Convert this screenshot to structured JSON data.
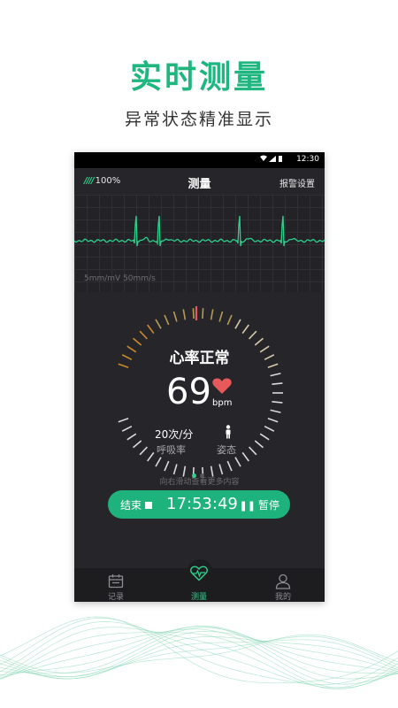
{
  "promo": {
    "title": "实时测量",
    "subtitle": "异常状态精准显示"
  },
  "status_bar": {
    "time": "12:30",
    "icons": [
      "wifi-icon",
      "signal-icon",
      "battery-icon"
    ]
  },
  "header": {
    "battery_text": "100%",
    "battery_bars": "////",
    "title": "测量",
    "alarm_settings": "报警设置"
  },
  "ecg": {
    "scale_label": "5mm/mV  50mm/s"
  },
  "measurement": {
    "status": "心率正常",
    "heart_rate": "69",
    "heart_rate_unit": "bpm",
    "respiration_value": "20次/分",
    "respiration_label": "呼吸率",
    "posture_label": "姿态",
    "page_count": 2,
    "active_page": 0,
    "swipe_hint": "向右滑动查看更多内容"
  },
  "controls": {
    "end_label": "结束",
    "timer": "17:53:49",
    "pause_label": "暂停"
  },
  "tabs": [
    {
      "label": "记录",
      "icon": "calendar-icon",
      "active": false
    },
    {
      "label": "测量",
      "icon": "heartbeat-icon",
      "active": true
    },
    {
      "label": "我的",
      "icon": "user-icon",
      "active": false
    }
  ],
  "colors": {
    "accent": "#1fb67f",
    "ecg_line": "#2fd08c",
    "heart": "#e8595b",
    "background": "#26262a"
  }
}
